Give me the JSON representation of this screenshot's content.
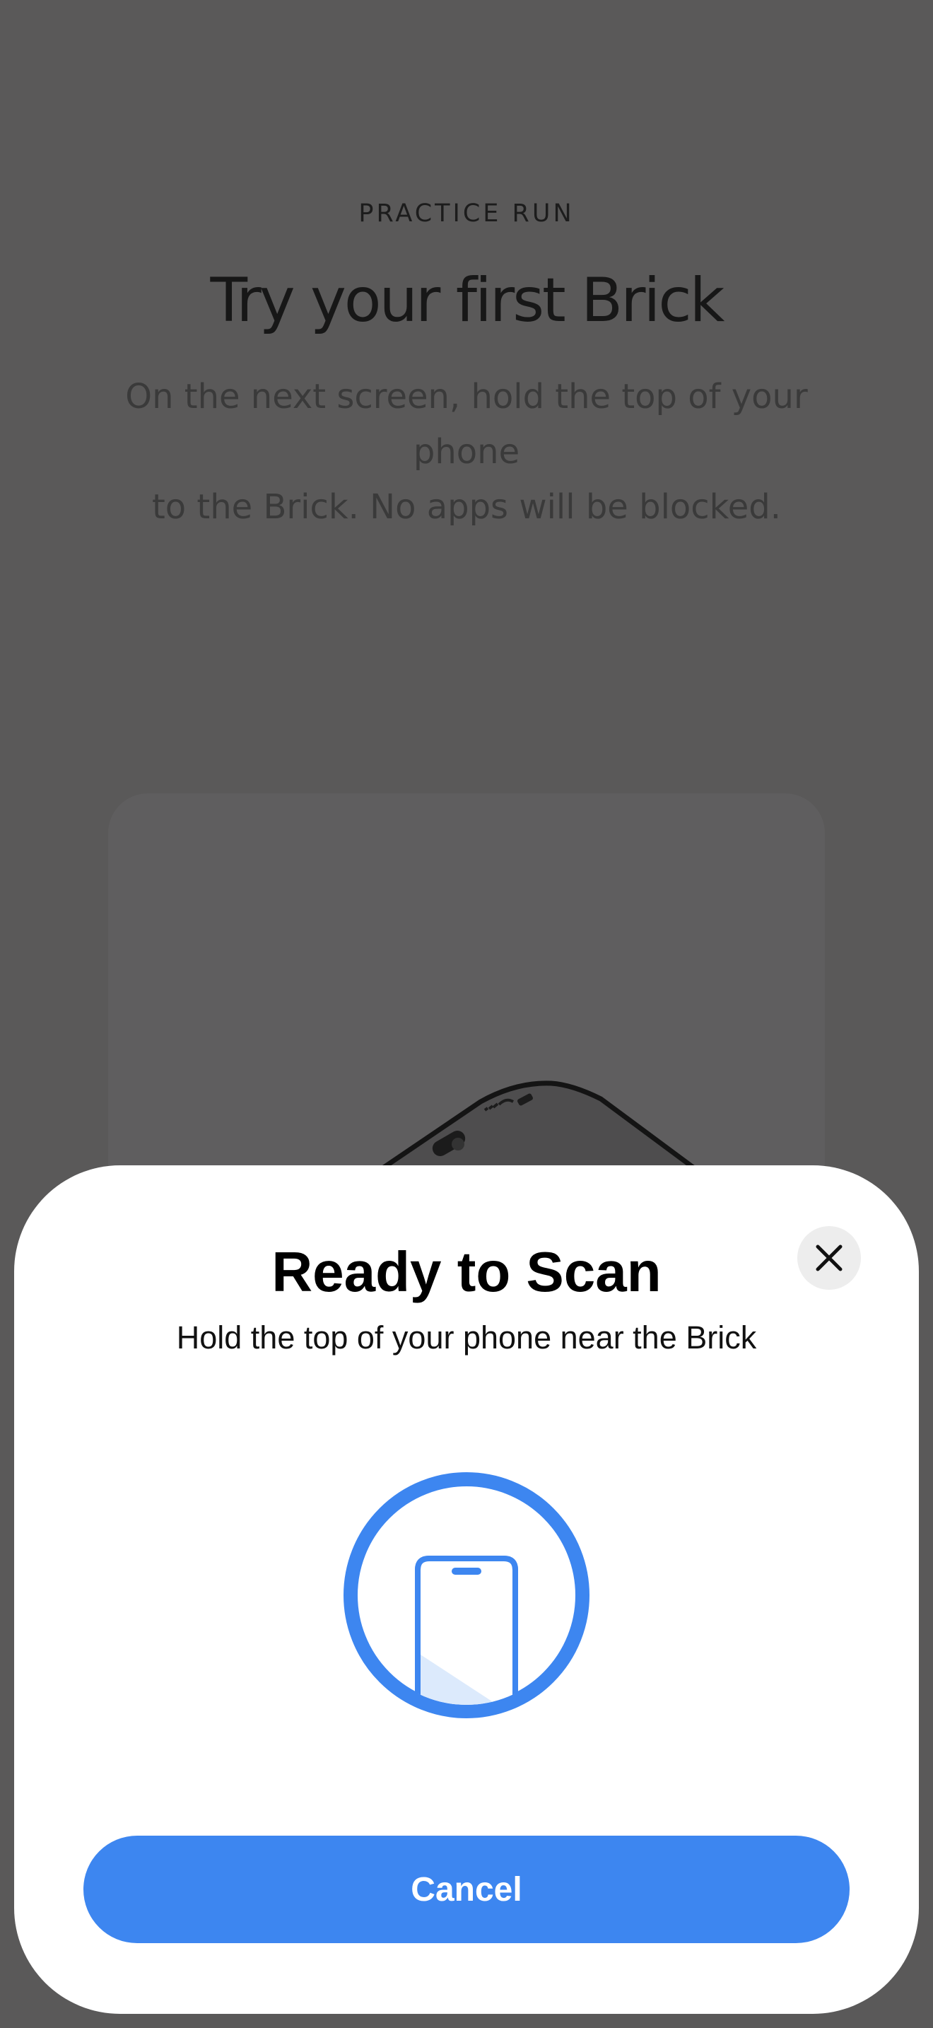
{
  "background": {
    "eyebrow": "PRACTICE RUN",
    "title": "Try your first Brick",
    "subtitle_line1": "On the next screen, hold the top of your phone",
    "subtitle_line2": "to the Brick. No apps will be blocked."
  },
  "sheet": {
    "title": "Ready to Scan",
    "subtitle": "Hold the top of your phone near the Brick",
    "close_icon": "close-icon",
    "scan_icon": "phone-scan-icon",
    "cancel_label": "Cancel"
  },
  "colors": {
    "accent": "#3d86f0",
    "accent_light": "#dceafc",
    "dim_background": "#5a5959",
    "sheet_background": "#ffffff"
  }
}
